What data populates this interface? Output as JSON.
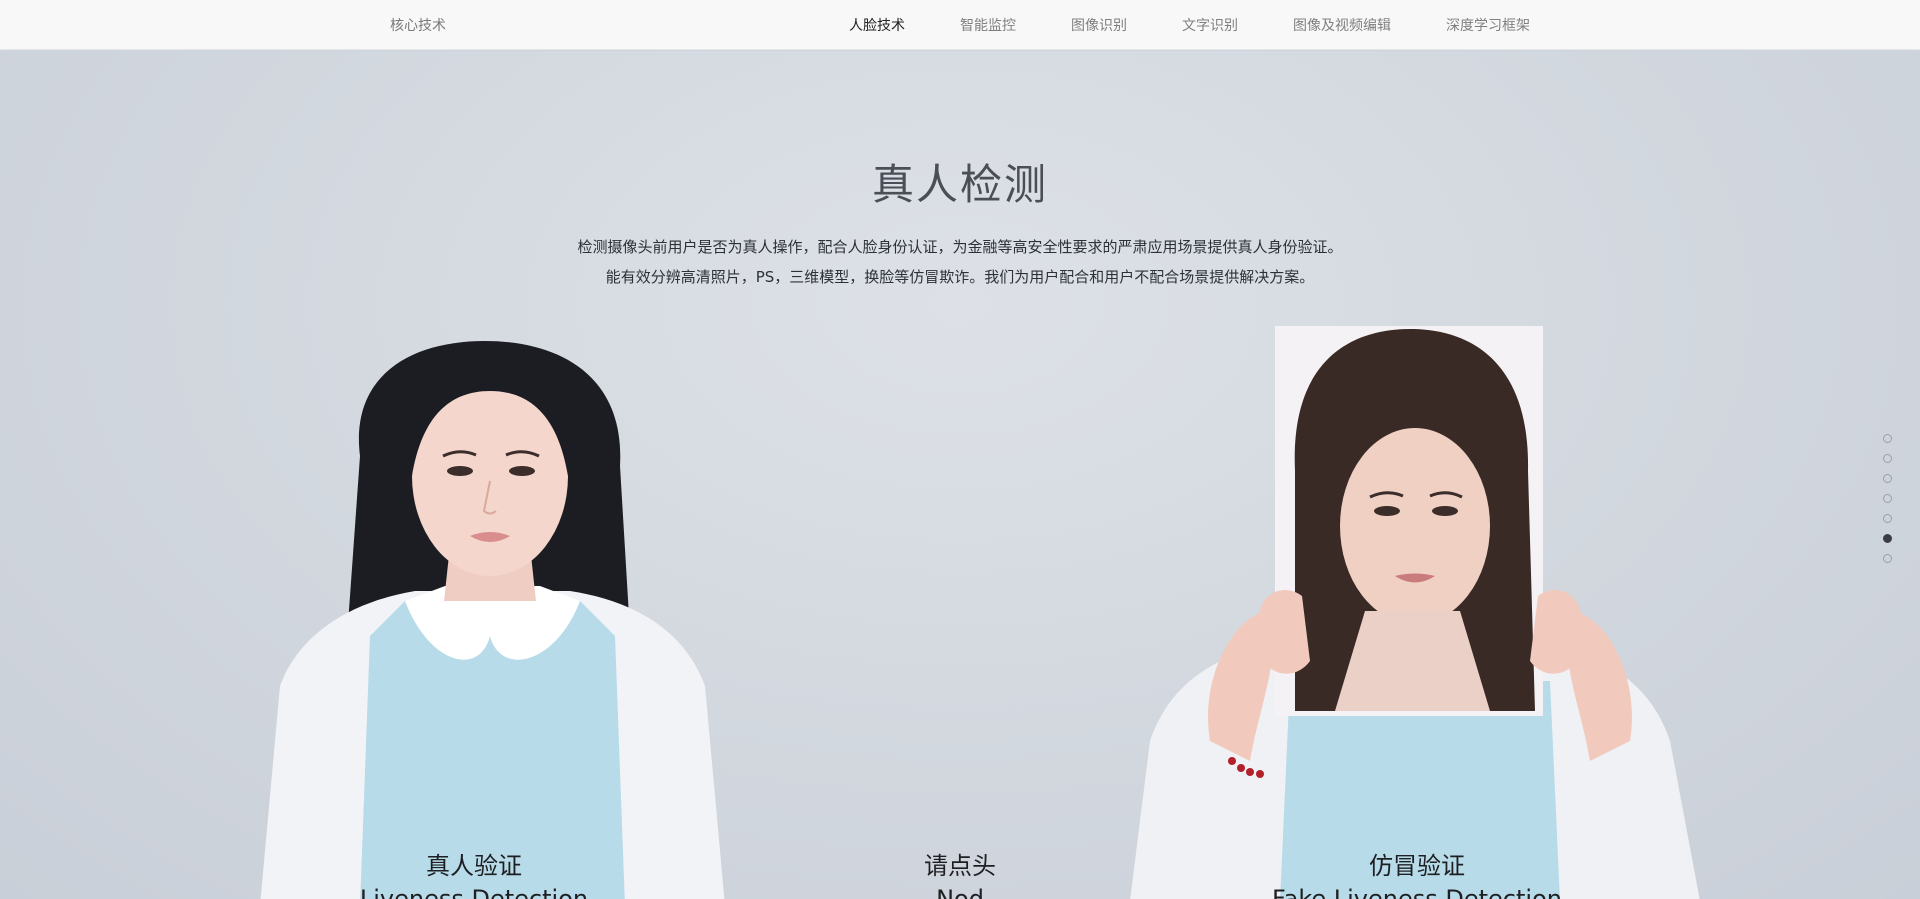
{
  "header": {
    "brand": "核心技术",
    "nav": [
      {
        "label": "人脸技术",
        "active": true
      },
      {
        "label": "智能监控",
        "active": false
      },
      {
        "label": "图像识别",
        "active": false
      },
      {
        "label": "文字识别",
        "active": false
      },
      {
        "label": "图像及视频编辑",
        "active": false
      },
      {
        "label": "深度学习框架",
        "active": false
      }
    ]
  },
  "section": {
    "title": "真人检测",
    "desc_line1": "检测摄像头前用户是否为真人操作，配合人脸身份认证，为金融等高安全性要求的严肃应用场景提供真人身份验证。",
    "desc_line2": "能有效分辨高清照片，PS，三维模型，换脸等仿冒欺诈。我们为用户配合和用户不配合场景提供解决方案。"
  },
  "captions": {
    "left_cn": "真人验证",
    "left_en": "Liveness Detection",
    "center_cn": "请点头",
    "center_en": "Nod",
    "right_cn": "仿冒验证",
    "right_en": "Fake Liveness Detection"
  },
  "pager": {
    "count": 7,
    "active_index": 5
  },
  "colors": {
    "topbar_bg": "#f8f8f8",
    "stage_bg": "#d4d9e0",
    "active_dot": "#3a3d42"
  }
}
